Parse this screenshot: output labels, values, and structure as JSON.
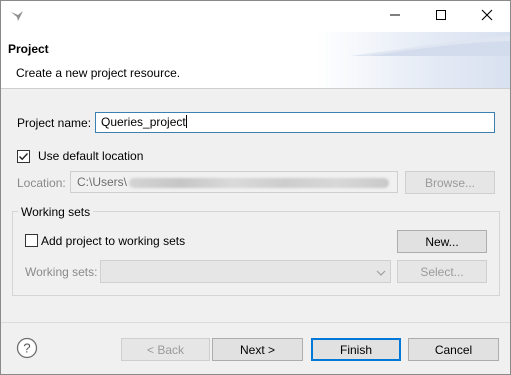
{
  "window": {
    "minimize_icon": "minimize-icon",
    "maximize_icon": "maximize-icon",
    "close_icon": "close-icon"
  },
  "header": {
    "title": "Project",
    "description": "Create a new project resource."
  },
  "form": {
    "project_name_label": "Project name:",
    "project_name_value": "Queries_project",
    "use_default_location_label": "Use default location",
    "use_default_location_checked": true,
    "location_label": "Location:",
    "location_value": "C:\\Users\\",
    "browse_button": "Browse..."
  },
  "working_sets": {
    "group_label": "Working sets",
    "add_checkbox_label": "Add project to working sets",
    "add_checkbox_checked": false,
    "new_button": "New...",
    "working_sets_label": "Working sets:",
    "select_button": "Select..."
  },
  "footer": {
    "help_icon": "help-icon",
    "back_button": "< Back",
    "next_button": "Next >",
    "finish_button": "Finish",
    "cancel_button": "Cancel"
  },
  "colors": {
    "focus_border": "#3c7fb1",
    "default_button_border": "#0078d7",
    "window_bg": "#f0f0f0",
    "disabled_text": "#9a9a9a"
  }
}
